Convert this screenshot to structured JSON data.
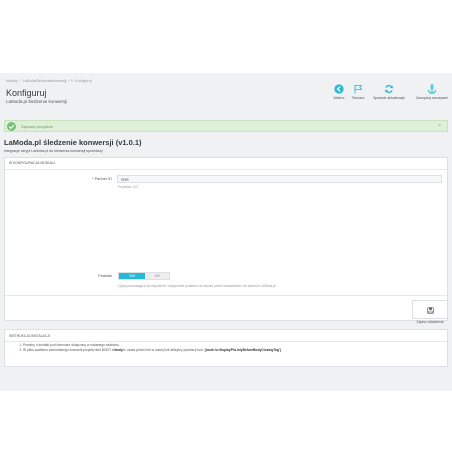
{
  "breadcrumb": {
    "item1": "Moduły",
    "item2": "LaModaSledzeniekonwersji",
    "item3": "Konfiguruj"
  },
  "header": {
    "title": "Konfiguruj",
    "subtitle": "LaModa.pl śledzenie konwersji"
  },
  "toolbar": {
    "back": "Wstecz",
    "translate": "Tłumacz",
    "check_update": "Sprawdź aktualizacje",
    "hooks": "Zarządzaj zaczepami"
  },
  "alert": {
    "text": "Zapisano pomyślnie",
    "close": "×"
  },
  "module": {
    "title": "LaModa.pl śledzenie konwersji (v1.0.1)",
    "description": "Integracje skrypt LaModa.pl do śledzenia konwersji sprzedaży"
  },
  "config_panel": {
    "heading": "KONFIGURACJA MODUŁU",
    "partner_label": "* Partner ID",
    "partner_value": "9999",
    "partner_hint": "Przykład: 123",
    "test_label": "Podsłań",
    "switch_on": "TAK",
    "switch_off": "NIE",
    "test_hint": "Opcja pozwalająca na włączenie i wyłączenie podłania na stronie przed wstawianiem do sewnice LaModa.pl",
    "save_label": "Zapisz ustawienia"
  },
  "instructions": {
    "heading": "INSTRUKCJA INSTALACJI",
    "step1": "Prosimy o kontakt pod formularz dołączony w nadanego szablonu.",
    "step2_pre": "W pliku szablonu zamodalnego znacznik przykła html BODY ",
    "step2_bold1": "</body>",
    "step2_mid": " i zaraz przed nim w nowej linii wklejony poniższy kod: ",
    "step2_bold2": "{hook h='displayPhListyBeforeBodyClosingTag'}"
  },
  "colors": {
    "accent": "#25b9d7",
    "success_bg": "#dff0d8",
    "success_icon": "#72c279"
  }
}
